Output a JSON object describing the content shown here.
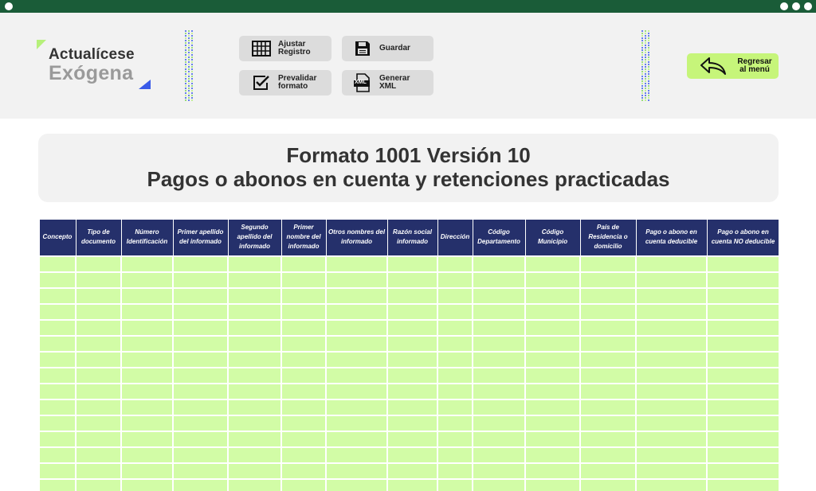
{
  "logo": {
    "line1": "Actualícese",
    "line2": "Exógena"
  },
  "toolbar": {
    "ajustar": "Ajustar Registro",
    "guardar": "Guardar",
    "prevalidar": "Prevalidar formato",
    "generar": "Generar XML",
    "xml_glyph": "XML"
  },
  "back_button": "Regresar al menú",
  "title": {
    "line1": "Formato 1001 Versión 10",
    "line2": "Pagos o abonos en cuenta y retenciones practicadas"
  },
  "table": {
    "columns": [
      "Concepto",
      "Tipo de documento",
      "Número Identificación",
      "Primer apellido del informado",
      "Segundo apellido del informado",
      "Primer nombre del informado",
      "Otros nombres del informado",
      "Razón social informado",
      "Dirección",
      "Código Departamento",
      "Código Municipio",
      "País de Residencia o domicilio",
      "Pago o abono en cuenta deducible",
      "Pago o abono en cuenta NO deducible"
    ],
    "row_count": 15
  },
  "colors": {
    "titlebar": "#1a5c38",
    "header_bg": "#f2f2f2",
    "button_bg": "#dcdcdc",
    "back_button_bg": "#c6f57a",
    "table_header_bg": "#25306b",
    "table_cell_bg": "#d2fca6",
    "logo_accent_green": "#b6f07a",
    "logo_accent_blue": "#3a5be8"
  },
  "icons": {
    "ajustar": "grid-icon",
    "guardar": "floppy-disk-icon",
    "prevalidar": "checkbox-icon",
    "generar": "xml-file-icon",
    "back": "back-arrow-icon"
  }
}
